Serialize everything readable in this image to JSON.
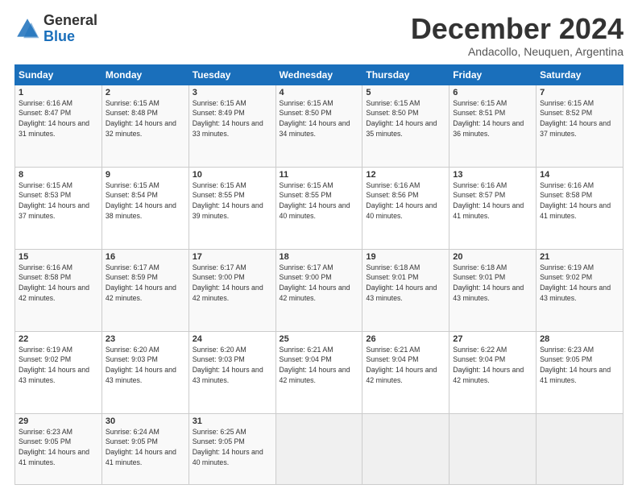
{
  "logo": {
    "general": "General",
    "blue": "Blue"
  },
  "title": "December 2024",
  "subtitle": "Andacollo, Neuquen, Argentina",
  "weekdays": [
    "Sunday",
    "Monday",
    "Tuesday",
    "Wednesday",
    "Thursday",
    "Friday",
    "Saturday"
  ],
  "weeks": [
    [
      {
        "day": "1",
        "sunrise": "6:16 AM",
        "sunset": "8:47 PM",
        "daylight": "14 hours and 31 minutes."
      },
      {
        "day": "2",
        "sunrise": "6:15 AM",
        "sunset": "8:48 PM",
        "daylight": "14 hours and 32 minutes."
      },
      {
        "day": "3",
        "sunrise": "6:15 AM",
        "sunset": "8:49 PM",
        "daylight": "14 hours and 33 minutes."
      },
      {
        "day": "4",
        "sunrise": "6:15 AM",
        "sunset": "8:50 PM",
        "daylight": "14 hours and 34 minutes."
      },
      {
        "day": "5",
        "sunrise": "6:15 AM",
        "sunset": "8:50 PM",
        "daylight": "14 hours and 35 minutes."
      },
      {
        "day": "6",
        "sunrise": "6:15 AM",
        "sunset": "8:51 PM",
        "daylight": "14 hours and 36 minutes."
      },
      {
        "day": "7",
        "sunrise": "6:15 AM",
        "sunset": "8:52 PM",
        "daylight": "14 hours and 37 minutes."
      }
    ],
    [
      {
        "day": "8",
        "sunrise": "6:15 AM",
        "sunset": "8:53 PM",
        "daylight": "14 hours and 37 minutes."
      },
      {
        "day": "9",
        "sunrise": "6:15 AM",
        "sunset": "8:54 PM",
        "daylight": "14 hours and 38 minutes."
      },
      {
        "day": "10",
        "sunrise": "6:15 AM",
        "sunset": "8:55 PM",
        "daylight": "14 hours and 39 minutes."
      },
      {
        "day": "11",
        "sunrise": "6:15 AM",
        "sunset": "8:55 PM",
        "daylight": "14 hours and 40 minutes."
      },
      {
        "day": "12",
        "sunrise": "6:16 AM",
        "sunset": "8:56 PM",
        "daylight": "14 hours and 40 minutes."
      },
      {
        "day": "13",
        "sunrise": "6:16 AM",
        "sunset": "8:57 PM",
        "daylight": "14 hours and 41 minutes."
      },
      {
        "day": "14",
        "sunrise": "6:16 AM",
        "sunset": "8:58 PM",
        "daylight": "14 hours and 41 minutes."
      }
    ],
    [
      {
        "day": "15",
        "sunrise": "6:16 AM",
        "sunset": "8:58 PM",
        "daylight": "14 hours and 42 minutes."
      },
      {
        "day": "16",
        "sunrise": "6:17 AM",
        "sunset": "8:59 PM",
        "daylight": "14 hours and 42 minutes."
      },
      {
        "day": "17",
        "sunrise": "6:17 AM",
        "sunset": "9:00 PM",
        "daylight": "14 hours and 42 minutes."
      },
      {
        "day": "18",
        "sunrise": "6:17 AM",
        "sunset": "9:00 PM",
        "daylight": "14 hours and 42 minutes."
      },
      {
        "day": "19",
        "sunrise": "6:18 AM",
        "sunset": "9:01 PM",
        "daylight": "14 hours and 43 minutes."
      },
      {
        "day": "20",
        "sunrise": "6:18 AM",
        "sunset": "9:01 PM",
        "daylight": "14 hours and 43 minutes."
      },
      {
        "day": "21",
        "sunrise": "6:19 AM",
        "sunset": "9:02 PM",
        "daylight": "14 hours and 43 minutes."
      }
    ],
    [
      {
        "day": "22",
        "sunrise": "6:19 AM",
        "sunset": "9:02 PM",
        "daylight": "14 hours and 43 minutes."
      },
      {
        "day": "23",
        "sunrise": "6:20 AM",
        "sunset": "9:03 PM",
        "daylight": "14 hours and 43 minutes."
      },
      {
        "day": "24",
        "sunrise": "6:20 AM",
        "sunset": "9:03 PM",
        "daylight": "14 hours and 43 minutes."
      },
      {
        "day": "25",
        "sunrise": "6:21 AM",
        "sunset": "9:04 PM",
        "daylight": "14 hours and 42 minutes."
      },
      {
        "day": "26",
        "sunrise": "6:21 AM",
        "sunset": "9:04 PM",
        "daylight": "14 hours and 42 minutes."
      },
      {
        "day": "27",
        "sunrise": "6:22 AM",
        "sunset": "9:04 PM",
        "daylight": "14 hours and 42 minutes."
      },
      {
        "day": "28",
        "sunrise": "6:23 AM",
        "sunset": "9:05 PM",
        "daylight": "14 hours and 41 minutes."
      }
    ],
    [
      {
        "day": "29",
        "sunrise": "6:23 AM",
        "sunset": "9:05 PM",
        "daylight": "14 hours and 41 minutes."
      },
      {
        "day": "30",
        "sunrise": "6:24 AM",
        "sunset": "9:05 PM",
        "daylight": "14 hours and 41 minutes."
      },
      {
        "day": "31",
        "sunrise": "6:25 AM",
        "sunset": "9:05 PM",
        "daylight": "14 hours and 40 minutes."
      },
      null,
      null,
      null,
      null
    ]
  ]
}
